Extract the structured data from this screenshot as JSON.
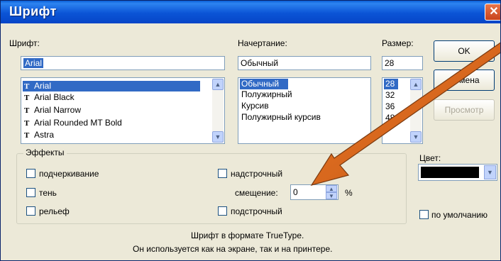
{
  "window": {
    "title": "Шрифт",
    "close_glyph": "✕"
  },
  "font": {
    "label": "Шрифт:",
    "value": "Arial",
    "items": [
      {
        "icon": "truetype-icon",
        "label": "Arial",
        "selected": true
      },
      {
        "icon": "truetype-icon",
        "label": "Arial Black"
      },
      {
        "icon": "truetype-icon",
        "label": "Arial Narrow"
      },
      {
        "icon": "truetype-icon",
        "label": "Arial Rounded MT Bold"
      },
      {
        "icon": "truetype-icon",
        "label": "Astra"
      }
    ]
  },
  "style": {
    "label": "Начертание:",
    "value": "Обычный",
    "items": [
      "Обычный",
      "Полужирный",
      "Курсив",
      "Полужирный курсив"
    ]
  },
  "size": {
    "label": "Размер:",
    "value": "28",
    "items": [
      "28",
      "32",
      "36",
      "48"
    ]
  },
  "buttons": {
    "ok": "OK",
    "cancel": "Отмена",
    "preview": "Просмотр"
  },
  "effects": {
    "title": "Эффекты",
    "underline": "подчеркивание",
    "shadow": "тень",
    "relief": "рельеф",
    "superscript": "надстрочный",
    "offset_label": "смещение:",
    "offset_value": "0",
    "offset_unit": "%",
    "subscript": "подстрочный"
  },
  "color": {
    "label": "Цвет:",
    "value_color": "#000000"
  },
  "default_label": "по умолчанию",
  "info": {
    "line1": "Шрифт в формате TrueType.",
    "line2": "Он используется как на экране, так и на принтере."
  },
  "icons": {
    "scroll_up": "▲",
    "scroll_down": "▼",
    "truetype_glyph": "T"
  }
}
